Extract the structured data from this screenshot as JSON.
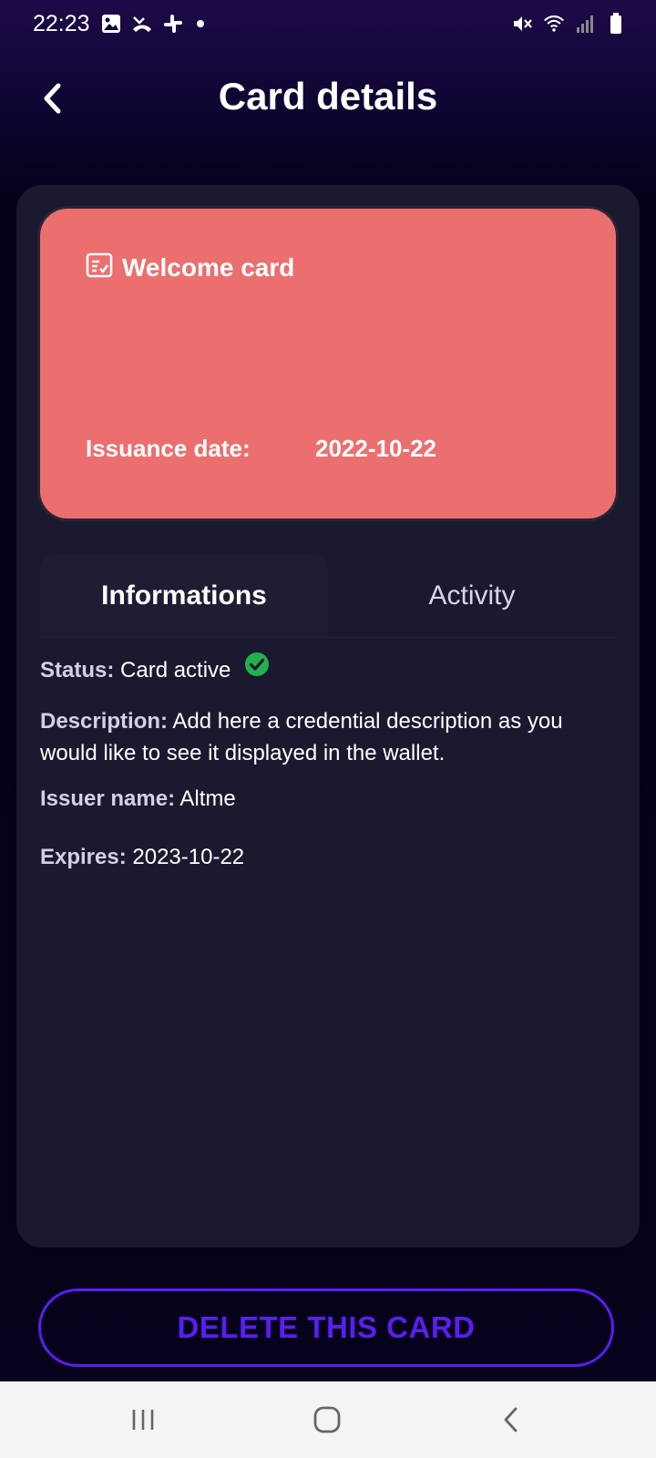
{
  "status_bar": {
    "time": "22:23",
    "left_icons": [
      "image-icon",
      "missed-call-icon",
      "slack-icon",
      "notification-dot"
    ],
    "right_icons": [
      "mute-icon",
      "wifi-icon",
      "signal-icon",
      "battery-icon"
    ]
  },
  "header": {
    "title": "Card details",
    "back_icon": "chevron-left-icon"
  },
  "card": {
    "icon": "credential-card-icon",
    "title": "Welcome card",
    "issuance_label": "Issuance date:",
    "issuance_value": "2022-10-22",
    "color": "#ec6f6f"
  },
  "tabs": [
    {
      "label": "Informations",
      "active": true
    },
    {
      "label": "Activity",
      "active": false
    }
  ],
  "info": {
    "status_label": "Status:",
    "status_value": "Card active",
    "status_icon": "check-circle-icon",
    "description_label": "Description:",
    "description_value": "Add here a credential description as you would like to see it displayed in the wallet.",
    "issuer_label": "Issuer name:",
    "issuer_value": "Altme",
    "expires_label": "Expires:",
    "expires_value": "2023-10-22"
  },
  "actions": {
    "delete_label": "DELETE THIS CARD"
  },
  "nav_bar": {
    "icons": [
      "recent-apps-icon",
      "home-icon",
      "back-icon"
    ]
  },
  "colors": {
    "accent": "#5b1df0",
    "status_ok": "#22b14c",
    "panel": "#1b1930"
  }
}
